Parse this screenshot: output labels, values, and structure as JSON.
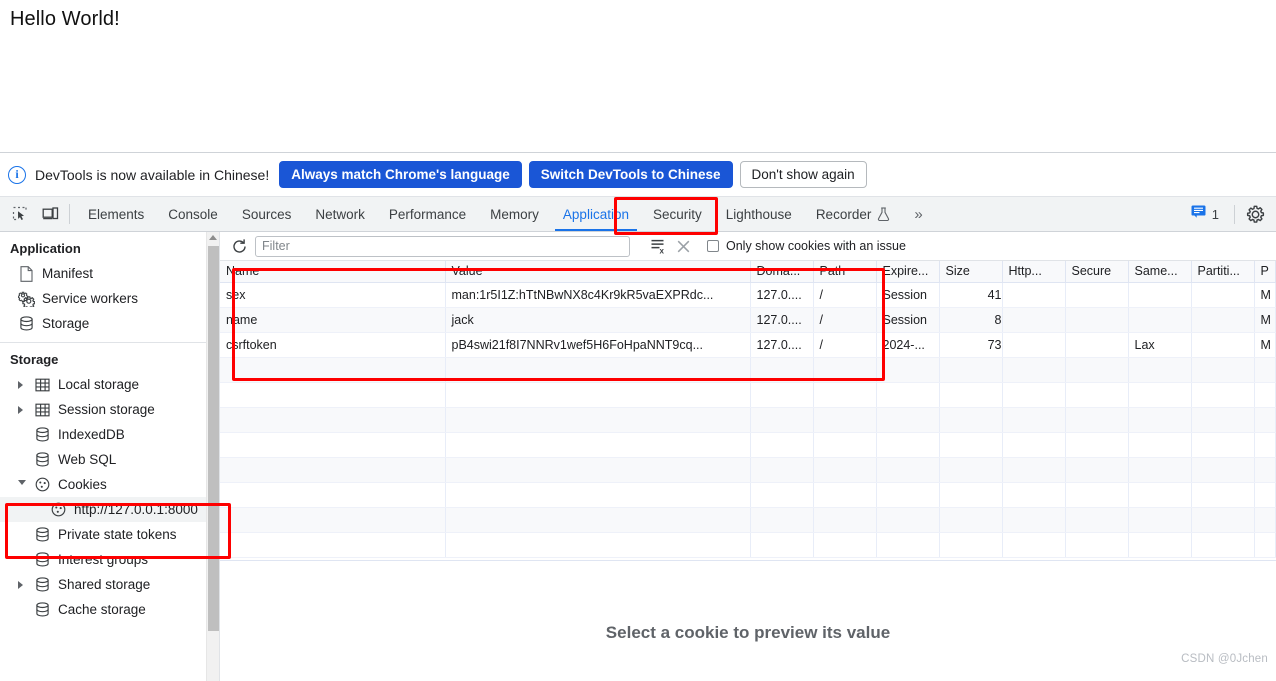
{
  "page": {
    "heading": "Hello World!"
  },
  "banner": {
    "info_icon": "info-icon",
    "message": "DevTools is now available in Chinese!",
    "primary_button": "Always match Chrome's language",
    "secondary_button": "Switch DevTools to Chinese",
    "dismiss_button": "Don't show again",
    "primary_color": "#1a56d6"
  },
  "tabbar": {
    "inspect_icon": "inspect-element-icon",
    "device_icon": "device-toolbar-icon",
    "tabs": [
      {
        "label": "Elements",
        "active": false
      },
      {
        "label": "Console",
        "active": false
      },
      {
        "label": "Sources",
        "active": false
      },
      {
        "label": "Network",
        "active": false
      },
      {
        "label": "Performance",
        "active": false
      },
      {
        "label": "Memory",
        "active": false
      },
      {
        "label": "Application",
        "active": true
      },
      {
        "label": "Security",
        "active": false
      },
      {
        "label": "Lighthouse",
        "active": false
      },
      {
        "label": "Recorder",
        "active": false
      }
    ],
    "recorder_badge_icon": "flask-icon",
    "more_tabs": "»",
    "issues_icon": "issues-message-icon",
    "issues_count": "1",
    "settings_icon": "gear-icon",
    "active_color": "#1a73e8"
  },
  "sidebar": {
    "sections": [
      {
        "title": "Application",
        "items": [
          {
            "label": "Manifest",
            "icon": "manifest-file-icon",
            "twisty": "none",
            "indent": 1,
            "selected": false
          },
          {
            "label": "Service workers",
            "icon": "service-workers-gear-icon",
            "twisty": "none",
            "indent": 1,
            "selected": false
          },
          {
            "label": "Storage",
            "icon": "database-icon",
            "twisty": "none",
            "indent": 1,
            "selected": false
          }
        ]
      },
      {
        "title": "Storage",
        "items": [
          {
            "label": "Local storage",
            "icon": "table-grid-icon",
            "twisty": "closed",
            "indent": 1,
            "selected": false
          },
          {
            "label": "Session storage",
            "icon": "table-grid-icon",
            "twisty": "closed",
            "indent": 1,
            "selected": false
          },
          {
            "label": "IndexedDB",
            "icon": "database-icon",
            "twisty": "none",
            "indent": 1,
            "selected": false
          },
          {
            "label": "Web SQL",
            "icon": "database-icon",
            "twisty": "none",
            "indent": 1,
            "selected": false
          },
          {
            "label": "Cookies",
            "icon": "cookie-icon",
            "twisty": "open",
            "indent": 1,
            "selected": false
          },
          {
            "label": "http://127.0.0.1:8000",
            "icon": "cookie-icon",
            "twisty": "none",
            "indent": 2,
            "selected": true
          },
          {
            "label": "Private state tokens",
            "icon": "database-icon",
            "twisty": "none",
            "indent": 1,
            "selected": false
          },
          {
            "label": "Interest groups",
            "icon": "database-icon",
            "twisty": "none",
            "indent": 1,
            "selected": false
          },
          {
            "label": "Shared storage",
            "icon": "database-icon",
            "twisty": "closed",
            "indent": 1,
            "selected": false
          },
          {
            "label": "Cache storage",
            "icon": "database-icon",
            "twisty": "none",
            "indent": 1,
            "selected": false
          }
        ]
      }
    ]
  },
  "cookie_toolbar": {
    "refresh_icon": "refresh-icon",
    "filter_placeholder": "Filter",
    "filter_value": "",
    "clear_filters_icon": "clear-filters-icon",
    "delete_all_icon": "clear-all-cookies-icon",
    "issue_checkbox_label": "Only show cookies with an issue",
    "issue_checkbox_checked": false
  },
  "cookie_table": {
    "columns": [
      "Name",
      "Value",
      "Doma...",
      "Path",
      "Expire...",
      "Size",
      "Http...",
      "Secure",
      "Same...",
      "Partiti...",
      "P"
    ],
    "rows": [
      {
        "name": "sex",
        "value": "man:1r5I1Z:hTtNBwNX8c4Kr9kR5vaEXPRdc...",
        "domain": "127.0....",
        "path": "/",
        "expires": "Session",
        "size": "41",
        "http_only": "",
        "secure": "",
        "same_site": "",
        "partition_key": "",
        "priority": "M"
      },
      {
        "name": "name",
        "value": "jack",
        "domain": "127.0....",
        "path": "/",
        "expires": "Session",
        "size": "8",
        "http_only": "",
        "secure": "",
        "same_site": "",
        "partition_key": "",
        "priority": "M"
      },
      {
        "name": "csrftoken",
        "value": "pB4swi21f8I7NNRv1wef5H6FoHpaNNT9cq...",
        "domain": "127.0....",
        "path": "/",
        "expires": "2024-...",
        "size": "73",
        "http_only": "",
        "secure": "",
        "same_site": "Lax",
        "partition_key": "",
        "priority": "M"
      }
    ]
  },
  "preview": {
    "empty_message": "Select a cookie to preview its value"
  },
  "watermark": {
    "text": "CSDN @0Jchen"
  },
  "annotations": {
    "highlight_color": "#fe0000",
    "boxes": [
      "application-tab",
      "cookie-table",
      "cookies-origin-tree-node"
    ]
  }
}
